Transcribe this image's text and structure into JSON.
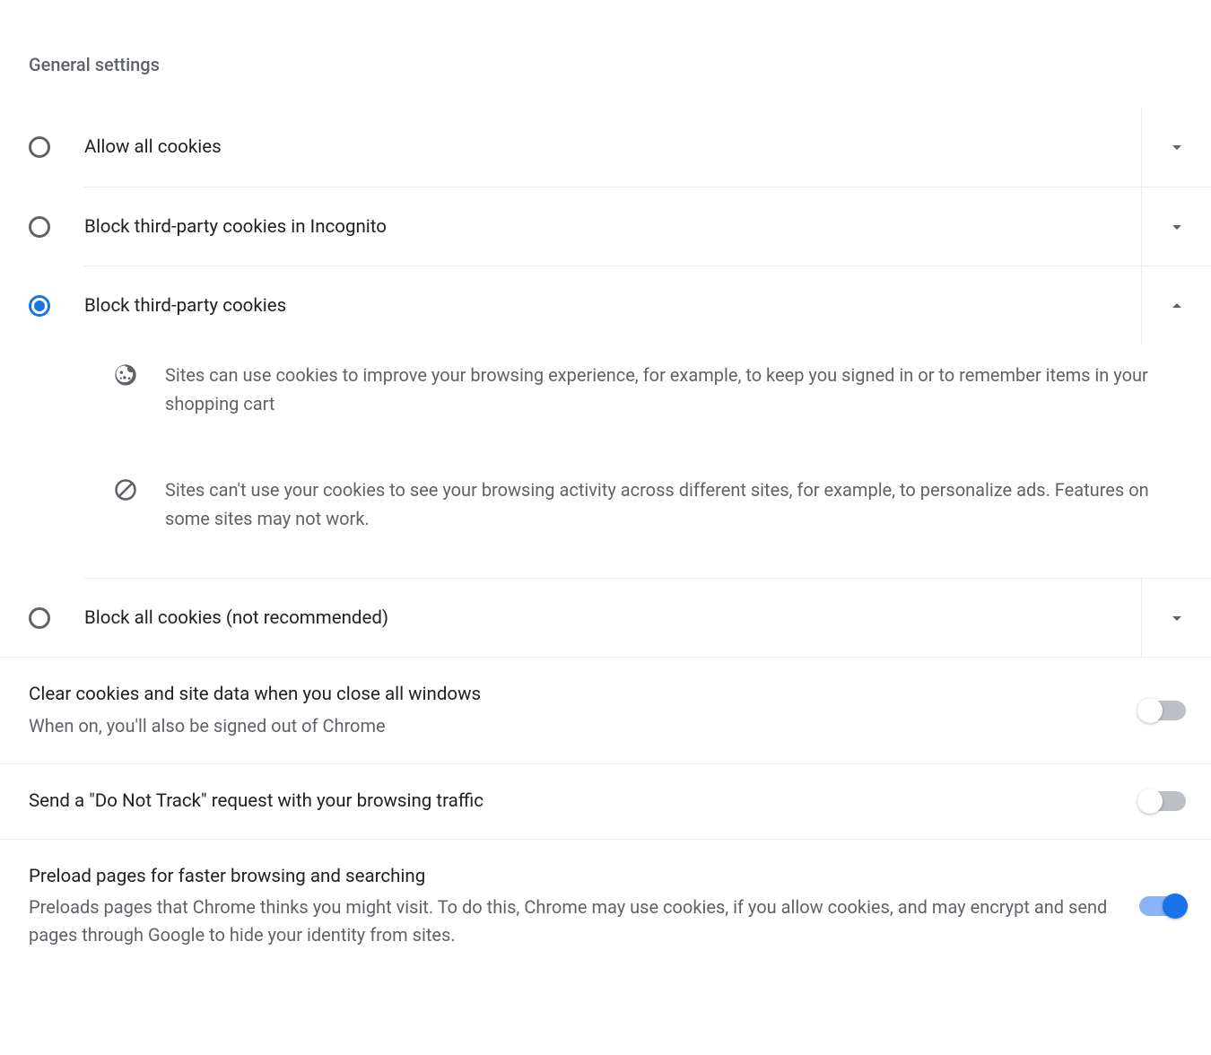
{
  "section_title": "General settings",
  "options": [
    {
      "label": "Allow all cookies",
      "selected": false,
      "expanded": false
    },
    {
      "label": "Block third-party cookies in Incognito",
      "selected": false,
      "expanded": false
    },
    {
      "label": "Block third-party cookies",
      "selected": true,
      "expanded": true
    },
    {
      "label": "Block all cookies (not recommended)",
      "selected": false,
      "expanded": false
    }
  ],
  "details": [
    "Sites can use cookies to improve your browsing experience, for example, to keep you signed in or to remember items in your shopping cart",
    "Sites can't use your cookies to see your browsing activity across different sites, for example, to personalize ads. Features on some sites may not work."
  ],
  "toggles": [
    {
      "title": "Clear cookies and site data when you close all windows",
      "subtitle": "When on, you'll also be signed out of Chrome",
      "on": false
    },
    {
      "title": "Send a \"Do Not Track\" request with your browsing traffic",
      "subtitle": "",
      "on": false
    },
    {
      "title": "Preload pages for faster browsing and searching",
      "subtitle": "Preloads pages that Chrome thinks you might visit. To do this, Chrome may use cookies, if you allow cookies, and may encrypt and send pages through Google to hide your identity from sites.",
      "on": true
    }
  ]
}
